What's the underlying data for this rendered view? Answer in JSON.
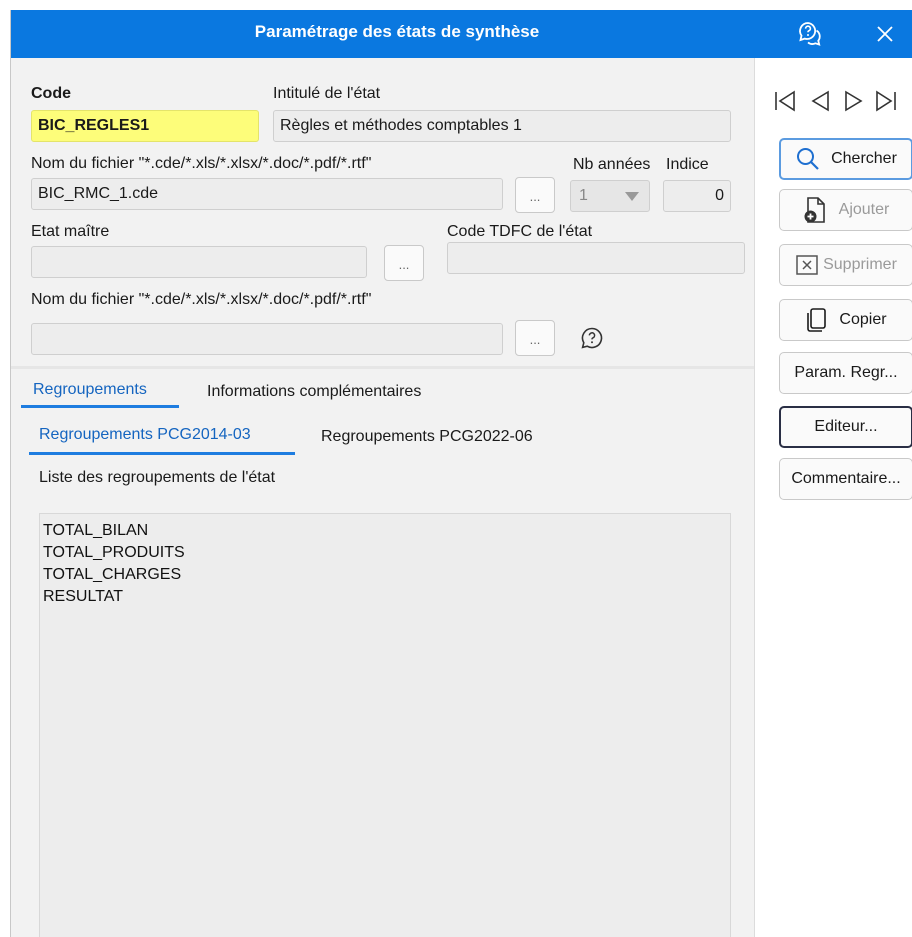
{
  "window": {
    "title": "Paramétrage des états de synthèse"
  },
  "form": {
    "code_label": "Code",
    "code_value": "BIC_REGLES1",
    "intitule_label": "Intitulé de l'état",
    "intitule_value": "Règles et méthodes comptables 1",
    "file_label": "Nom du fichier \"*.cde/*.xls/*.xlsx/*.doc/*.pdf/*.rtf\"",
    "file_value": "BIC_RMC_1.cde",
    "nb_annees_label": "Nb années",
    "nb_annees_value": "1",
    "indice_label": "Indice",
    "indice_value": "0",
    "etat_maitre_label": "Etat maître",
    "etat_maitre_value": "",
    "tdfc_label": "Code TDFC de l'état",
    "tdfc_value": "",
    "file2_label": "Nom du fichier \"*.cde/*.xls/*.xlsx/*.doc/*.pdf/*.rtf\"",
    "file2_value": "",
    "browse_label": "..."
  },
  "tabs": {
    "main": [
      "Regroupements",
      "Informations complémentaires"
    ],
    "sub": [
      "Regroupements PCG2014-03",
      "Regroupements PCG2022-06"
    ]
  },
  "list": {
    "label": "Liste des regroupements de l'état",
    "items": [
      "TOTAL_BILAN",
      "TOTAL_PRODUITS",
      "TOTAL_CHARGES",
      "RESULTAT"
    ]
  },
  "side": {
    "chercher": "Chercher",
    "ajouter": "Ajouter",
    "supprimer": "Supprimer",
    "copier": "Copier",
    "param": "Param. Regr...",
    "editeur": "Editeur...",
    "commentaire": "Commentaire..."
  },
  "colors": {
    "title_bar": "#0a78e0",
    "code_field": "#fdfd7a",
    "tab_accent": "#1e7de0"
  }
}
